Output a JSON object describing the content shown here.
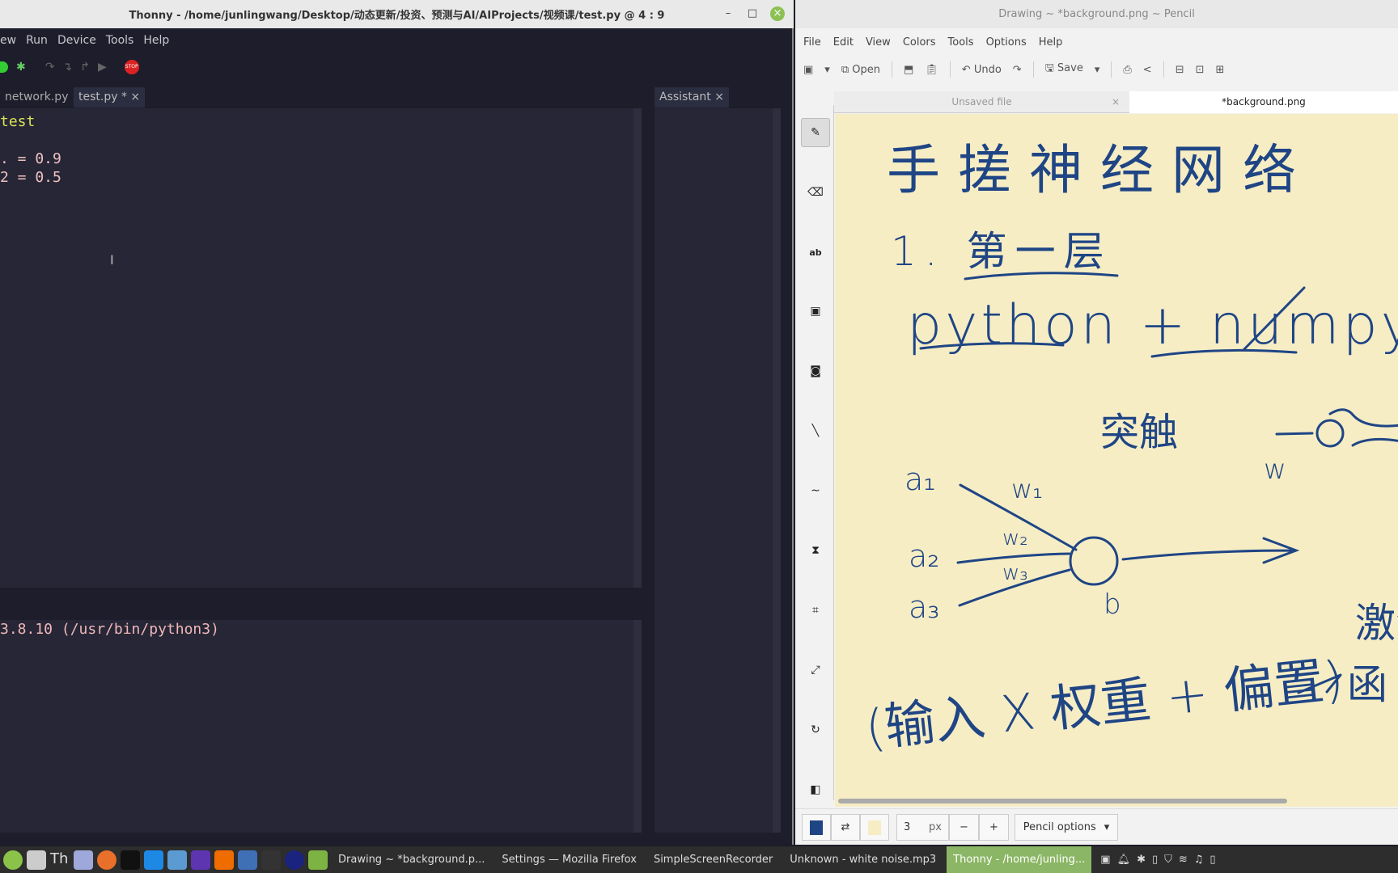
{
  "thonny": {
    "title": "Thonny  -  /home/junlingwang/Desktop/动态更新/投资、预测与AI/AIProjects/视频课/test.py  @  4 : 9",
    "menu": [
      "ew",
      "Run",
      "Device",
      "Tools",
      "Help"
    ],
    "tabs": [
      {
        "label": "network.py ×"
      },
      {
        "label": "test.py * ×"
      }
    ],
    "assistant_tab": "Assistant ×",
    "code": [
      {
        "text": "test",
        "color": "#d9e35a"
      },
      {
        "text": "",
        "color": "#ccc"
      },
      {
        "text": ". = 0.9",
        "color": "#f0b7b7"
      },
      {
        "text": "2 = 0.5",
        "color": "#f0b7b7"
      }
    ],
    "shell": "3.8.10 (/usr/bin/python3)",
    "stop_label": "STOP"
  },
  "pencil": {
    "title": "Drawing ~ *background.png ~ Pencil",
    "menu": [
      "File",
      "Edit",
      "View",
      "Colors",
      "Tools",
      "Options",
      "Help"
    ],
    "toolbar": {
      "open": "Open",
      "undo": "Undo",
      "save": "Save"
    },
    "tabs": [
      {
        "label": "Unsaved file"
      },
      {
        "label": "*background.png"
      }
    ],
    "tools": [
      "pencil",
      "eraser",
      "text",
      "rect-select",
      "free-select",
      "line",
      "curve",
      "warp",
      "crop",
      "scale",
      "rotate",
      "gradient"
    ],
    "canvas": {
      "heading": "手搓神经网络",
      "section": "1. 第一层",
      "tech": "python + numpy",
      "synapse": "突触",
      "w": "w",
      "a1": "a₁",
      "a2": "a₂",
      "a3": "a₃",
      "w1": "w₁",
      "w2": "w₂",
      "w3": "w₃",
      "b": "b",
      "activation": "激活",
      "func": "函",
      "formula": "(输入 X 权重 + 偏置)",
      "ink_color": "#1f4585",
      "paper_color": "#f6edc4"
    },
    "bottom": {
      "size": "3",
      "unit": "px",
      "minus": "−",
      "plus": "+",
      "options": "Pencil options",
      "primary_color": "#1f4585",
      "secondary_color": "#f6edc4"
    }
  },
  "taskbar": {
    "tasks": [
      {
        "label": "Drawing ~ *background.p..."
      },
      {
        "label": "Settings — Mozilla Firefox"
      },
      {
        "label": "SimpleScreenRecorder"
      },
      {
        "label": "Unknown - white noise.mp3"
      },
      {
        "label": "Thonny  -  /home/junling..."
      }
    ]
  }
}
